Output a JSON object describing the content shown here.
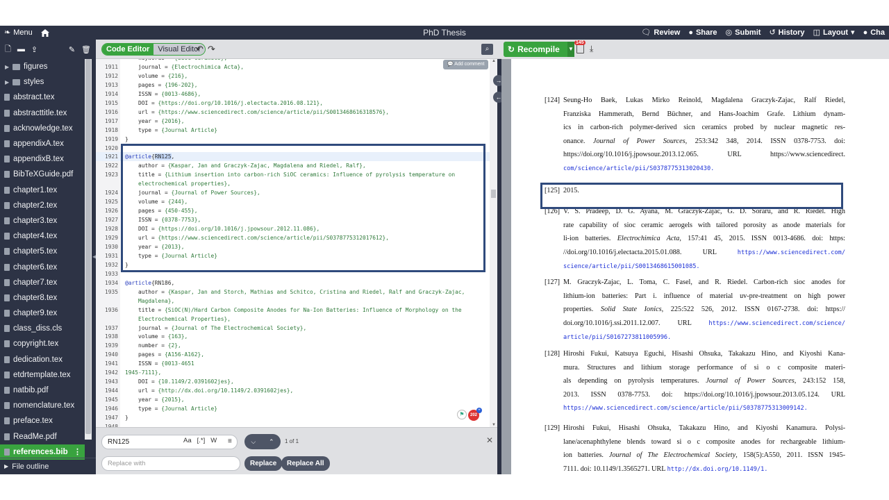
{
  "topbar": {
    "menu": "Menu",
    "title": "PhD Thesis",
    "review": "Review",
    "share": "Share",
    "submit": "Submit",
    "history": "History",
    "layout": "Layout",
    "chat": "Cha"
  },
  "toolbar": {
    "code_editor": "Code Editor",
    "visual_editor": "Visual Editor",
    "recompile": "Recompile",
    "log_badge": "145"
  },
  "sidebar": {
    "items": [
      {
        "label": "figures",
        "type": "folder"
      },
      {
        "label": "styles",
        "type": "folder"
      },
      {
        "label": "abstract.tex",
        "type": "file"
      },
      {
        "label": "abstracttitle.tex",
        "type": "file"
      },
      {
        "label": "acknowledge.tex",
        "type": "file"
      },
      {
        "label": "appendixA.tex",
        "type": "file"
      },
      {
        "label": "appendixB.tex",
        "type": "file"
      },
      {
        "label": "BibTeXGuide.pdf",
        "type": "file"
      },
      {
        "label": "chapter1.tex",
        "type": "file"
      },
      {
        "label": "chapter2.tex",
        "type": "file"
      },
      {
        "label": "chapter3.tex",
        "type": "file"
      },
      {
        "label": "chapter4.tex",
        "type": "file"
      },
      {
        "label": "chapter5.tex",
        "type": "file"
      },
      {
        "label": "chapter6.tex",
        "type": "file"
      },
      {
        "label": "chapter7.tex",
        "type": "file"
      },
      {
        "label": "chapter8.tex",
        "type": "file"
      },
      {
        "label": "chapter9.tex",
        "type": "file"
      },
      {
        "label": "class_diss.cls",
        "type": "file"
      },
      {
        "label": "copyright.tex",
        "type": "file"
      },
      {
        "label": "dedication.tex",
        "type": "file"
      },
      {
        "label": "etdrtemplate.tex",
        "type": "file"
      },
      {
        "label": "natbib.pdf",
        "type": "file"
      },
      {
        "label": "nomenclature.tex",
        "type": "file"
      },
      {
        "label": "preface.tex",
        "type": "file"
      },
      {
        "label": "ReadMe.pdf",
        "type": "file"
      },
      {
        "label": "references.bib",
        "type": "file",
        "active": true
      }
    ],
    "file_outline": "File outline"
  },
  "editor": {
    "add_comment": "Add comment",
    "lines": [
      {
        "n": "",
        "t": "    keywords = {SiOC ceramics},"
      },
      {
        "n": "1911",
        "t": "    journal = {Electrochimica Acta},"
      },
      {
        "n": "1912",
        "t": "    volume = {216},"
      },
      {
        "n": "1913",
        "t": "    pages = {196-202},"
      },
      {
        "n": "1914",
        "t": "    ISSN = {0013-4686},"
      },
      {
        "n": "1915",
        "t": "    DOI = {https://doi.org/10.1016/j.electacta.2016.08.121},"
      },
      {
        "n": "1916",
        "t": "    url = {https://www.sciencedirect.com/science/article/pii/S0013468616318576},"
      },
      {
        "n": "1917",
        "t": "    year = {2016},"
      },
      {
        "n": "1918",
        "t": "    type = {Journal Article}"
      },
      {
        "n": "1919",
        "t": "}"
      },
      {
        "n": "1920",
        "t": ""
      },
      {
        "n": "1921",
        "t": "@article{RN125,"
      },
      {
        "n": "1922",
        "t": "    author = {Kaspar, Jan and Graczyk-Zajac, Magdalena and Riedel, Ralf},"
      },
      {
        "n": "1923",
        "t": "    title = {Lithium insertion into carbon-rich SiOC ceramics: Influence of pyrolysis temperature on"
      },
      {
        "n": "",
        "t": "    electrochemical properties},"
      },
      {
        "n": "1924",
        "t": "    journal = {Journal of Power Sources},"
      },
      {
        "n": "1925",
        "t": "    volume = {244},"
      },
      {
        "n": "1926",
        "t": "    pages = {450-455},"
      },
      {
        "n": "1927",
        "t": "    ISSN = {0378-7753},"
      },
      {
        "n": "1928",
        "t": "    DOI = {https://doi.org/10.1016/j.jpowsour.2012.11.086},"
      },
      {
        "n": "1929",
        "t": "    url = {https://www.sciencedirect.com/science/article/pii/S0378775312017612},"
      },
      {
        "n": "1930",
        "t": "    year = {2013},"
      },
      {
        "n": "1931",
        "t": "    type = {Journal Article}"
      },
      {
        "n": "1932",
        "t": "}"
      },
      {
        "n": "1933",
        "t": ""
      },
      {
        "n": "1934",
        "t": "@article{RN186,"
      },
      {
        "n": "1935",
        "t": "    author = {Kaspar, Jan and Storch, Mathias and Schitco, Cristina and Riedel, Ralf and Graczyk-Zajac,"
      },
      {
        "n": "",
        "t": "    Magdalena},"
      },
      {
        "n": "1936",
        "t": "    title = {SiOC(N)/Hard Carbon Composite Anodes for Na-Ion Batteries: Influence of Morphology on the"
      },
      {
        "n": "",
        "t": "    Electrochemical Properties},"
      },
      {
        "n": "1937",
        "t": "    journal = {Journal of The Electrochemical Society},"
      },
      {
        "n": "1938",
        "t": "    volume = {163},"
      },
      {
        "n": "1939",
        "t": "    number = {2},"
      },
      {
        "n": "1940",
        "t": "    pages = {A156-A162},"
      },
      {
        "n": "1941",
        "t": "    ISSN = {0013-4651"
      },
      {
        "n": "1942",
        "t": "1945-7111},"
      },
      {
        "n": "1943",
        "t": "    DOI = {10.1149/2.0391602jes},"
      },
      {
        "n": "1944",
        "t": "    url = {http://dx.doi.org/10.1149/2.0391602jes},"
      },
      {
        "n": "1945",
        "t": "    year = {2015},"
      },
      {
        "n": "1946",
        "t": "    type = {Journal Article}"
      },
      {
        "n": "1947",
        "t": "}"
      },
      {
        "n": "1948",
        "t": ""
      }
    ],
    "float_badge": "202"
  },
  "find": {
    "query": "RN125",
    "opt_case": "Aa",
    "opt_regex": "[.*]",
    "opt_word": "W",
    "count": "1 of 1",
    "replace_placeholder": "Replace with",
    "replace": "Replace",
    "replace_all": "Replace All"
  },
  "pdf": {
    "refs": [
      {
        "num": "[124]",
        "lines": [
          "Seung-Ho Baek, Lukas Mirko Reinold, Magdalena Graczyk-Zajac, Ralf Riedel,",
          "Franziska Hammerath, Bernd Büchner, and Hans-Joachim Grafe. Lithium dynam-",
          "ics in carbon-rich polymer-derived sicn ceramics probed by nuclear magnetic res-",
          "onance. Journal of Power Sources, 253:342 348, 2014. ISSN 0378-7753. doi:",
          "https://doi.org/10.1016/j.jpowsour.2013.12.065. URL https://www.sciencedirect.",
          "com/science/article/pii/S0378775313020430."
        ]
      },
      {
        "num": "[125]",
        "lines": [
          "2015."
        ]
      },
      {
        "num": "[126]",
        "lines": [
          "V. S. Pradeep, D. G. Ayana, M. Graczyk-Zajac, G. D. Soraru, and R. Riedel. High",
          "rate capability of sioc ceramic aerogels with tailored porosity as anode materials for",
          "li-ion batteries. Electrochimica Acta, 157:41 45, 2015. ISSN 0013-4686. doi: https:",
          "//doi.org/10.1016/j.electacta.2015.01.088. URL https://www.sciencedirect.com/",
          "science/article/pii/S0013468615001085."
        ]
      },
      {
        "num": "[127]",
        "lines": [
          "M. Graczyk-Zajac, L. Toma, C. Fasel, and R. Riedel. Carbon-rich sioc anodes for",
          "lithium-ion batteries: Part i. influence of material uv-pre-treatment on high power",
          "properties. Solid State Ionics, 225:522 526, 2012. ISSN 0167-2738. doi: https://",
          "doi.org/10.1016/j.ssi.2011.12.007. URL https://www.sciencedirect.com/science/",
          "article/pii/S0167273811005996."
        ]
      },
      {
        "num": "[128]",
        "lines": [
          "Hiroshi Fukui, Katsuya Eguchi, Hisashi Ohsuka, Takakazu Hino, and Kiyoshi Kana-",
          "mura. Structures and lithium storage performance of si o c composite materi-",
          "als depending on pyrolysis temperatures. Journal of Power Sources, 243:152 158,",
          "2013. ISSN 0378-7753. doi: https://doi.org/10.1016/j.jpowsour.2013.05.124. URL",
          "https://www.sciencedirect.com/science/article/pii/S0378775313009142."
        ]
      },
      {
        "num": "[129]",
        "lines": [
          "Hiroshi Fukui, Hisashi Ohsuka, Takakazu Hino, and Kiyoshi Kanamura. Polysi-",
          "lane/acenaphthylene blends toward si o c composite anodes for rechargeable lithium-",
          "ion batteries. Journal of The Electrochemical Society, 158(5):A550, 2011. ISSN 1945-",
          "7111. doi: 10.1149/1.3565271. URL http://dx.doi.org/10.1149/1."
        ]
      }
    ]
  },
  "colors": {
    "dark": "#2d3345",
    "green": "#39a33f",
    "highlight_box": "#2f4a7c"
  }
}
